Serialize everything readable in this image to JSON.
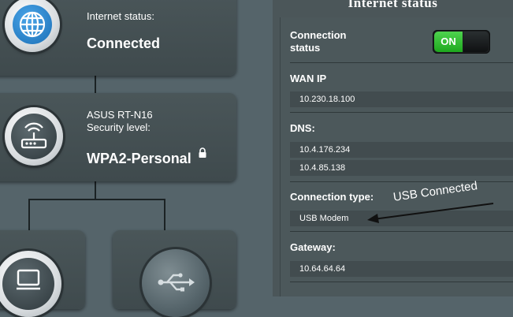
{
  "network_map": {
    "internet_card": {
      "status_label": "Internet status:",
      "status_value": "Connected"
    },
    "router_card": {
      "model": "ASUS RT-N16",
      "security_label": "Security level:",
      "security_value": "WPA2-Personal"
    }
  },
  "panel": {
    "title": "Internet status",
    "connection_status": {
      "label_line1": "Connection",
      "label_line2": "status",
      "toggle": "ON"
    },
    "wan_ip": {
      "label": "WAN IP",
      "value": "10.230.18.100"
    },
    "dns": {
      "label": "DNS:",
      "values": [
        "10.4.176.234",
        "10.4.85.138"
      ]
    },
    "connection_type": {
      "label": "Connection type:",
      "value": "USB Modem"
    },
    "gateway": {
      "label": "Gateway:",
      "value": "10.64.64.64"
    }
  },
  "annotation": "USB Connected",
  "icons": [
    "globe-icon",
    "router-icon",
    "lock-icon",
    "computer-icon",
    "usb-icon"
  ],
  "colors": {
    "toggle_on": "#2cbf2c",
    "background": "#55646a"
  }
}
